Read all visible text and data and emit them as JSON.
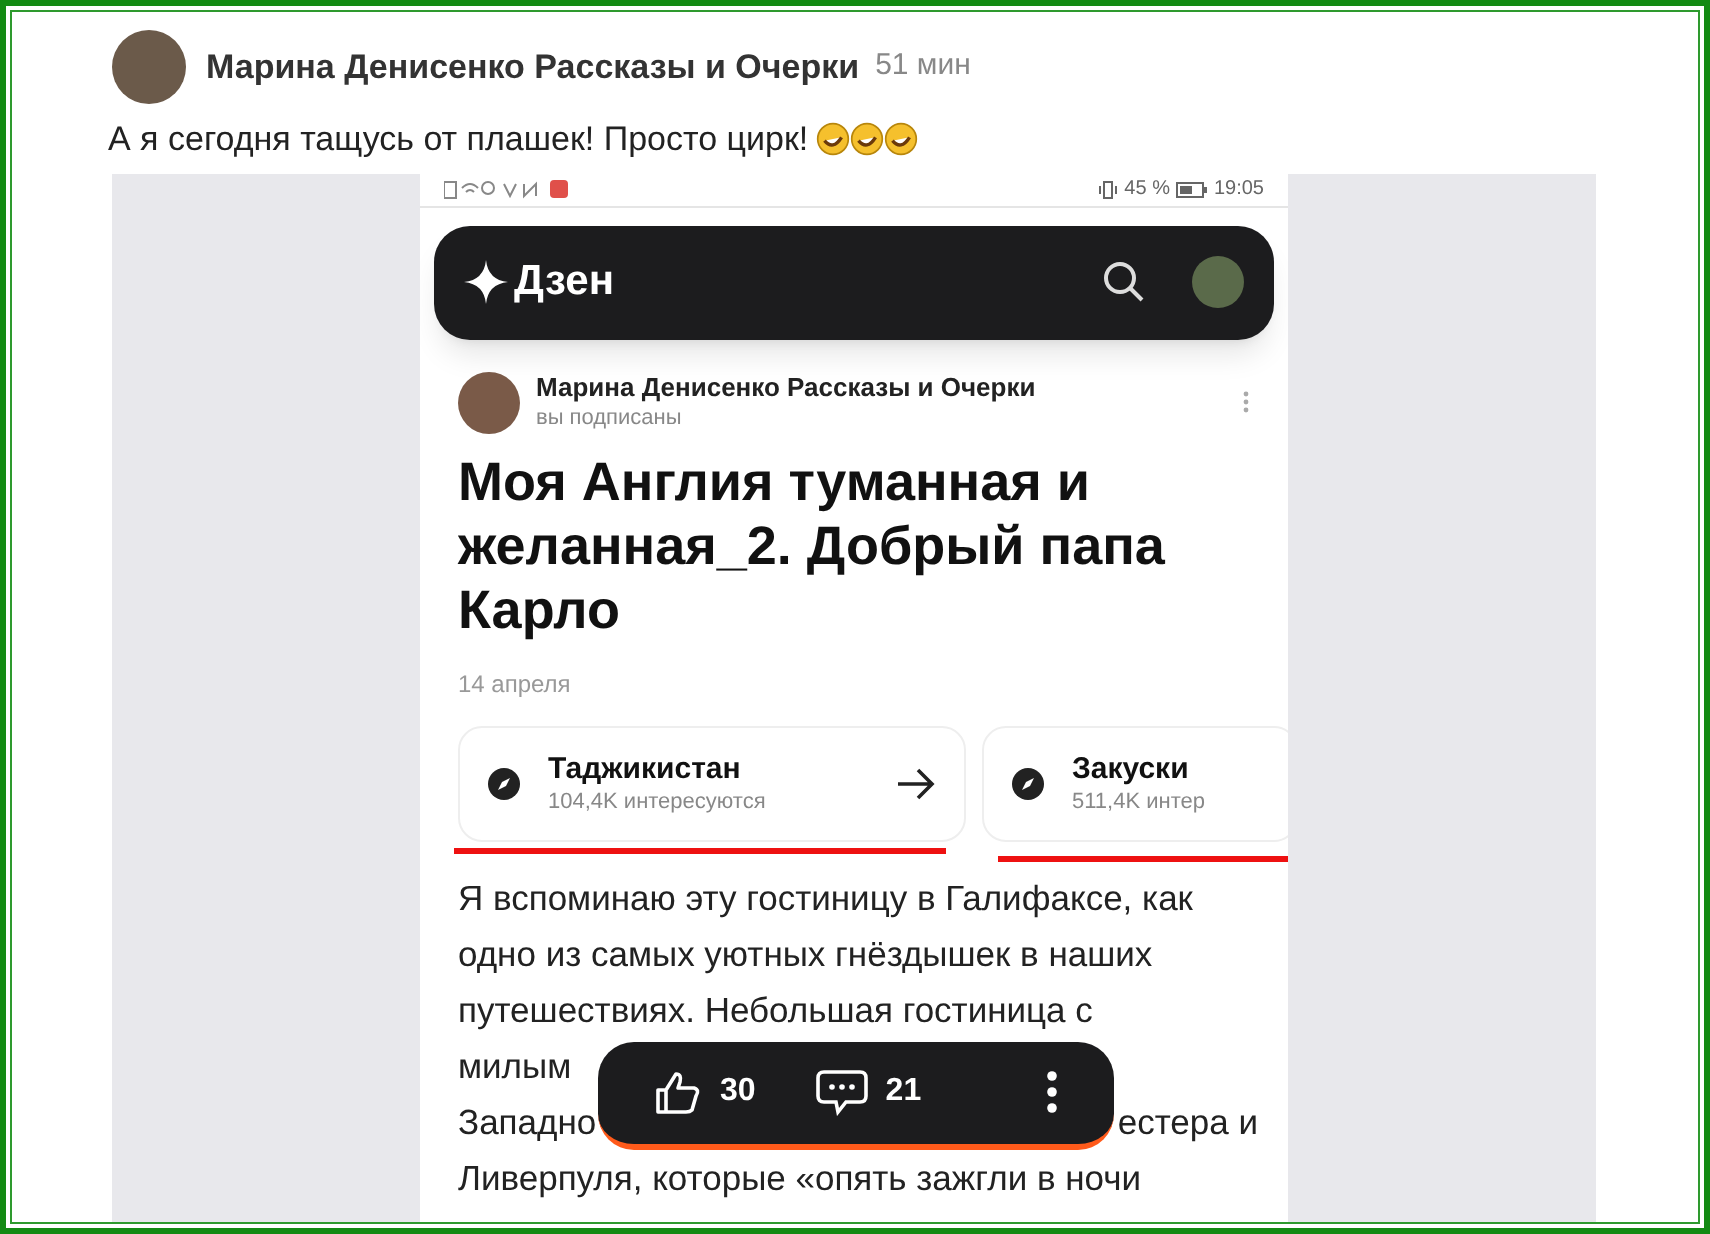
{
  "post": {
    "author": "Марина Денисенко Рассказы и Очерки",
    "time": "51 мин",
    "text": "А я сегодня тащусь от плашек! Просто цирк!"
  },
  "phone": {
    "status_bar": {
      "battery": "45 %",
      "clock": "19:05"
    },
    "app_bar": {
      "title": "Дзен"
    },
    "article": {
      "author": "Марина Денисенко Рассказы и Очерки",
      "subscription": "вы подписаны",
      "title": "Моя Англия туманная и желанная_2. Добрый папа Карло",
      "date": "14 апреля",
      "topics": [
        {
          "title": "Таджикистан",
          "subtitle": "104,4K интересуются",
          "arrow": true
        },
        {
          "title": "Закуски",
          "subtitle": "511,4K интер",
          "arrow": false
        }
      ],
      "body_lines": [
        [
          "Я вспоминаю эту гостиницу в Галифаксе, как"
        ],
        [
          "одно из самых уютных гнёздышек в наших"
        ],
        [
          "путешествиях. Небольшая гостиница с"
        ],
        [
          "милым"
        ],
        [
          "Западно",
          "естера и"
        ],
        [
          "Ливерпуля, которые «опять зажгли в ночи"
        ]
      ]
    },
    "action_bar": {
      "likes": "30",
      "comments": "21"
    }
  }
}
